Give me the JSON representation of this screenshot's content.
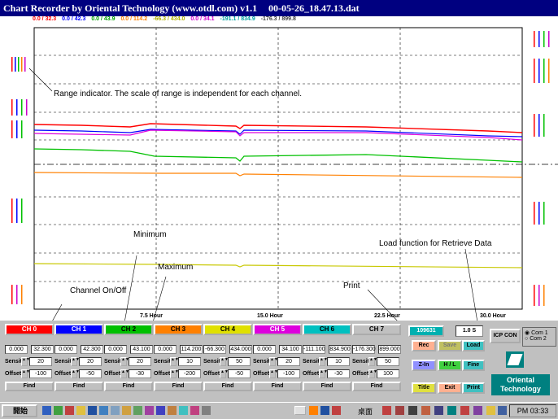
{
  "window": {
    "title": "Chart Recorder by Oriental Technology (www.otdl.com) v1.1",
    "filename": "00-05-26_18.47.13.dat"
  },
  "range_bar": [
    {
      "text": "0.0 / 32.3",
      "color": "#ff0000"
    },
    {
      "text": "0.0 / 42.3",
      "color": "#0000ff"
    },
    {
      "text": "0.0 / 43.9",
      "color": "#00a000"
    },
    {
      "text": "0.0 / 114.2",
      "color": "#ff8000"
    },
    {
      "text": "-66.3 / 434.0",
      "color": "#b0b000"
    },
    {
      "text": "0.0 / 34.1",
      "color": "#cc00cc"
    },
    {
      "text": "-191.1 / 834.9",
      "color": "#00a0a0"
    },
    {
      "text": "-176.3 / 899.8",
      "color": "#404040"
    }
  ],
  "annotations": {
    "range": "Range indicator. The scale of range is independent for each channel.",
    "minimum": "Minimum",
    "maximum": "Maximum",
    "channel": "Channel On/Off",
    "print": "Print",
    "load": "Load function for Retrieve Data"
  },
  "axis": {
    "ticks": [
      "7.5 Hour",
      "15.0 Hour",
      "22.5 Hour",
      "30.0 Hour"
    ]
  },
  "channels": [
    {
      "name": "CH 0",
      "color": "#ff0000",
      "min": "0.000",
      "max": "32.300",
      "sensit": "20",
      "offset": "-100",
      "find": "Find"
    },
    {
      "name": "CH 1",
      "color": "#0000ff",
      "min": "0.000",
      "max": "42.300",
      "sensit": "20",
      "offset": "-50",
      "find": "Find"
    },
    {
      "name": "CH 2",
      "color": "#00c000",
      "min": "0.000",
      "max": "43.100",
      "sensit": "20",
      "offset": "-30",
      "find": "Find"
    },
    {
      "name": "CH 3",
      "color": "#ff8000",
      "min": "0.000",
      "max": "114.200",
      "sensit": "10",
      "offset": "-200",
      "find": "Find"
    },
    {
      "name": "CH 4",
      "color": "#e0e000",
      "min": "-66.300",
      "max": "434.000",
      "sensit": "50",
      "offset": "-50",
      "find": "Find"
    },
    {
      "name": "CH 5",
      "color": "#dd00dd",
      "min": "0.000",
      "max": "34.100",
      "sensit": "20",
      "offset": "-100",
      "find": "Find"
    },
    {
      "name": "CH 6",
      "color": "#00c0c0",
      "min": "-111.100",
      "max": "834.900",
      "sensit": "10",
      "offset": "-30",
      "find": "Find"
    },
    {
      "name": "CH 7",
      "color": "#c0c0c0",
      "min": "-176.300",
      "max": "899.000",
      "sensit": "50",
      "offset": "100",
      "find": "Find"
    }
  ],
  "labels": {
    "sensit": "Sensit",
    "offset": "Offset"
  },
  "controls": {
    "counter": "109631",
    "interval": "1.0 S",
    "rec": "Rec",
    "save": "Save",
    "load": "Load",
    "zin": "Z-In",
    "hl": "H / L",
    "fine": "Fine",
    "title": "Title",
    "exit": "Exit",
    "print": "Print",
    "icp": "ICP CON",
    "com1": "Com 1",
    "com2": "Com 2",
    "company": "Oriental Technology"
  },
  "taskbar": {
    "start": "開始",
    "tray_text": "桌面",
    "clock": "PM 03:33"
  }
}
